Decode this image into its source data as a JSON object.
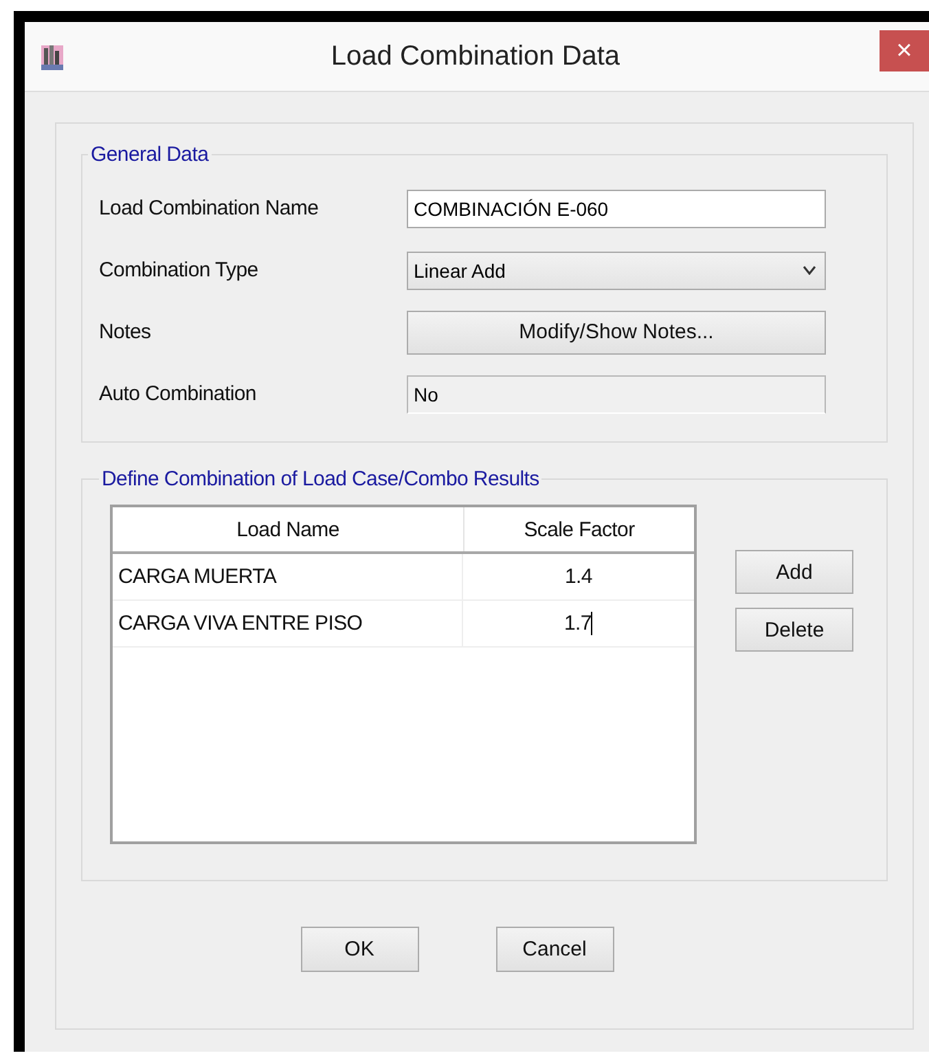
{
  "window": {
    "title": "Load Combination Data",
    "close": "×"
  },
  "general_data": {
    "title": "General Data",
    "fields": [
      {
        "kind": "text",
        "label": "Load Combination Name",
        "value": "COMBINACIÓN E-060"
      },
      {
        "kind": "dropdown",
        "label": "Combination Type",
        "value": "Linear Add"
      },
      {
        "kind": "button",
        "label": "Notes",
        "value": "Modify/Show Notes..."
      },
      {
        "kind": "readonly",
        "label": "Auto Combination",
        "value": "No"
      }
    ]
  },
  "combination": {
    "title": "Define Combination of Load Case/Combo Results",
    "columns": [
      "Load Name",
      "Scale Factor"
    ],
    "rows": [
      {
        "load_name": "CARGA MUERTA",
        "scale_factor": "1.4",
        "editing": false
      },
      {
        "load_name": "CARGA VIVA ENTRE PISO",
        "scale_factor": "1.7",
        "editing": true
      }
    ],
    "buttons": [
      "Add",
      "Delete"
    ]
  },
  "buttons": [
    "OK",
    "Cancel"
  ]
}
